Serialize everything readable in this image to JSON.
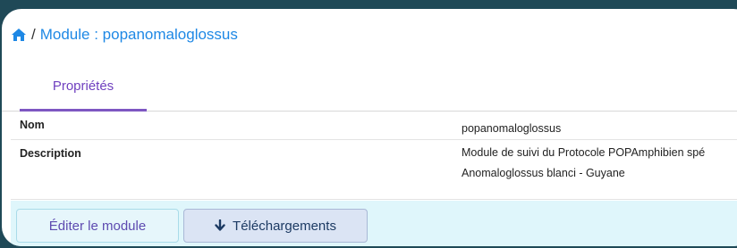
{
  "breadcrumb": {
    "separator": "/",
    "title": "Module : popanomaloglossus"
  },
  "tabs": [
    {
      "label": "Propriétés",
      "active": true
    }
  ],
  "properties": [
    {
      "key": "Nom",
      "value_lines": [
        "popanomaloglossus"
      ]
    },
    {
      "key": "Description",
      "value_lines": [
        "Module de suivi du Protocole POPAmphibien spé",
        "Anomaloglossus blanci - Guyane"
      ]
    }
  ],
  "actions": {
    "edit_label": "Éditer le module",
    "download_label": "Téléchargements"
  },
  "icons": {
    "home": "home-icon",
    "download": "arrow-down-icon"
  },
  "colors": {
    "link": "#1e88e5",
    "tab_accent": "#7e57c2",
    "frame": "#1f4957",
    "actions_bg": "#dff6fb"
  }
}
